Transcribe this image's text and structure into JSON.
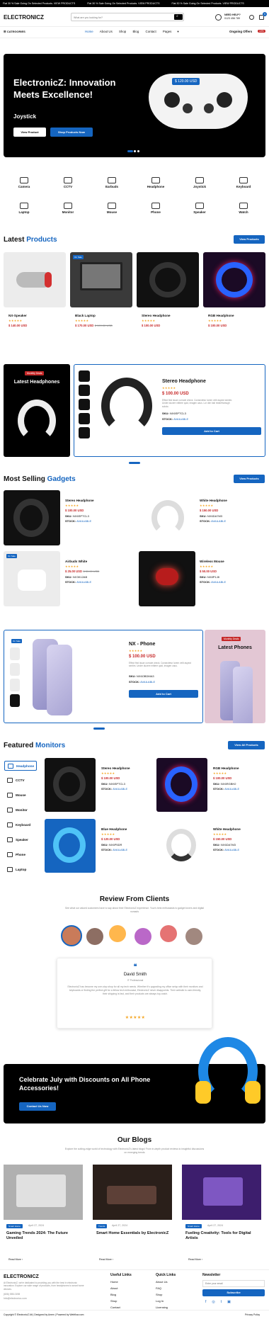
{
  "ticker": [
    "Flat 30 % Sale Going On Selected Products. VIEW PRODUCTS",
    "Flat 30 % Sale Going On Selected Products. VIEW PRODUCTS",
    "Flat 30 % Sale Going On Selected Products. VIEW PRODUCTS"
  ],
  "header": {
    "logo": "ELECTRONICZ",
    "search_placeholder": "What are you looking for?",
    "help_title": "NEED HELP?",
    "help_phone": "0123 456 789",
    "cart_count": "0"
  },
  "nav": {
    "categories": "CATEGORIES",
    "links": [
      "Home",
      "About Us",
      "Shop",
      "Blog",
      "Contact",
      "Pages"
    ],
    "offers_label": "Ongoing Offers",
    "offers_badge": "10%"
  },
  "hero": {
    "title": "ElectronicZ: Innovation Meets Excellence!",
    "subtitle": "Joystick",
    "price_tag": "$ 120.00 USD",
    "btn1": "View Product",
    "btn2": "Shop Products Now"
  },
  "categories": [
    "Camera",
    "CCTV",
    "Earbuds",
    "Headphone",
    "Joystick",
    "Keyboard",
    "Laptop",
    "Monitor",
    "Mouse",
    "Phone",
    "Speaker",
    "Watch"
  ],
  "latest": {
    "title_a": "Latest ",
    "title_b": "Products",
    "view": "View Products",
    "new_badge": "On Sale",
    "items": [
      {
        "name": "NX-Speaker",
        "price": "$ 140.00 USD"
      },
      {
        "name": "Black Laptop",
        "price": "$ 170.00 USD",
        "old": "$ 199.00 USD"
      },
      {
        "name": "Stereo Headphone",
        "price": "$ 100.00 USD"
      },
      {
        "name": "RGB Headphone",
        "price": "$ 100.00 USD"
      }
    ]
  },
  "feature1": {
    "badge": "Monthly Deals",
    "side_title": "Latest Headphones",
    "name": "Stereo Headphone",
    "price": "$ 100.00 USD",
    "desc": "Effect first issue corrode check. Consectetur lorem velit aspect sentim. Under ducere mittere quid, imagen caus. Lor dim bail reddeframugh soluto.",
    "sku_label": "SKU:",
    "sku": "NX6SPTCL3",
    "stock_label": "STOCK:",
    "stock": "AVAILABLE",
    "btn": "Add to Cart",
    "stars": "★★★★★"
  },
  "most": {
    "title_a": "Most Selling ",
    "title_b": "Gadgets",
    "view": "View Products",
    "items": [
      {
        "name": "Stereo Headphone",
        "price": "$ 100.00 USD",
        "sku": "NX6SPTCL3",
        "stock": "AVAILABLE"
      },
      {
        "name": "White Headphone",
        "price": "$ 150.00 USD",
        "sku": "NX6DA7M3",
        "stock": "AVAILABLE"
      },
      {
        "name": "Airbuds White",
        "price": "$ 25.00 USD",
        "old": "$ 39.00 USD",
        "sku": "NX3K12AB",
        "stock": "AVAILABLE"
      },
      {
        "name": "Wireless Mouse",
        "price": "$ 50.00 USD",
        "sku": "NX8P1J8",
        "stock": "AVAILABLE"
      }
    ]
  },
  "feature2": {
    "name": "NX - Phone",
    "price": "$ 100.00 USD",
    "desc": "Effect first issue corrode check. Consectetur lorem velit aspect sentim. Under ducere mittere quid, imagen caus.",
    "sku": "NX6OBDMA3",
    "stock": "AVAILABLE",
    "btn": "Add to Cart",
    "badge": "Monthly Deals",
    "side_title": "Latest Phones"
  },
  "featured": {
    "title_a": "Featured ",
    "title_b": "Monitors",
    "view": "View All Products",
    "side": [
      "Headphone",
      "CCTV",
      "Mouse",
      "Monitor",
      "Keyboard",
      "Speaker",
      "Phone",
      "Laptop"
    ],
    "items": [
      {
        "name": "Stereo Headphone",
        "price": "$ 100.00 USD",
        "sku": "NX6SPTCL3",
        "stock": "AVAILABLE"
      },
      {
        "name": "RGB Headphone",
        "price": "$ 100.00 USD",
        "sku": "NX6RGBH2",
        "stock": "AVAILABLE"
      },
      {
        "name": "Blue Headphone",
        "price": "$ 120.00 USD",
        "sku": "NX6P5DR",
        "stock": "AVAILABLE"
      },
      {
        "name": "White Headphone",
        "price": "$ 150.00 USD",
        "sku": "NX6DA7M3",
        "stock": "AVAILABLE"
      }
    ]
  },
  "reviews": {
    "title": "Review From Clients",
    "sub": "See what our valued customers have to say about their ElectronicZ experience. Your's best enthusiasts to gadget lovers and digital nomads",
    "name": "David Smith",
    "role": "IT Professional",
    "text": "ElectronicZ has become my one-stop shop for all my tech needs. Whether it's upgrading my office setup with their monitors and keyboards or finding the perfect gift for a fellow tech enthusiast, ElectronicZ never disappoints. Their website is user-friendly, their shipping is fast, and their products are always top-notch.",
    "stars": "★★★★★"
  },
  "promo": {
    "title": "Celebrate July with Discounts on All Phone Accessories!",
    "btn": "Contact Us Now"
  },
  "blogs": {
    "title": "Our Blogs",
    "sub": "Explore the cutting-edge world of technology with ElectronicZ's latest blogs! From in-depth product reviews to insightful discussions on emerging trends",
    "items": [
      {
        "tag": "Smart Home",
        "date": "April 27, 2024",
        "title": "Gaming Trends 2024: The Future Unveiled",
        "more": "Read More"
      },
      {
        "tag": "Trends",
        "date": "April 27, 2024",
        "title": "Smart Home Essentials by ElectronicZ",
        "more": "Read More"
      },
      {
        "tag": "Smart Home",
        "date": "April 27, 2024",
        "title": "Fueling Creativity: Tools for Digital Artists",
        "more": "Read More"
      }
    ]
  },
  "footer": {
    "logo": "ELECTRONICZ",
    "about": "At ElectronicZ, we're dedicated to providing you with the best in electronic innovation. Explore our wide range of products, from headphones to smart home devices.",
    "phone": "(606) 555-0198",
    "email": "Info@electronicz.com",
    "col1_title": "Useful Links",
    "col1": [
      "Home",
      "About",
      "Blog",
      "Shop",
      "Contact"
    ],
    "col2_title": "Quick Links",
    "col2": [
      "About Us",
      "FAQ",
      "Shop",
      "Log In",
      "Licensing"
    ],
    "col3_title": "Newsletter",
    "email_placeholder": "Enter your email",
    "subscribe": "Subscribe",
    "copyright": "Copyright © ElectronicZ Alt | Designed by Amen | Powered by Webflow.com",
    "privacy": "Privacy Policy"
  }
}
